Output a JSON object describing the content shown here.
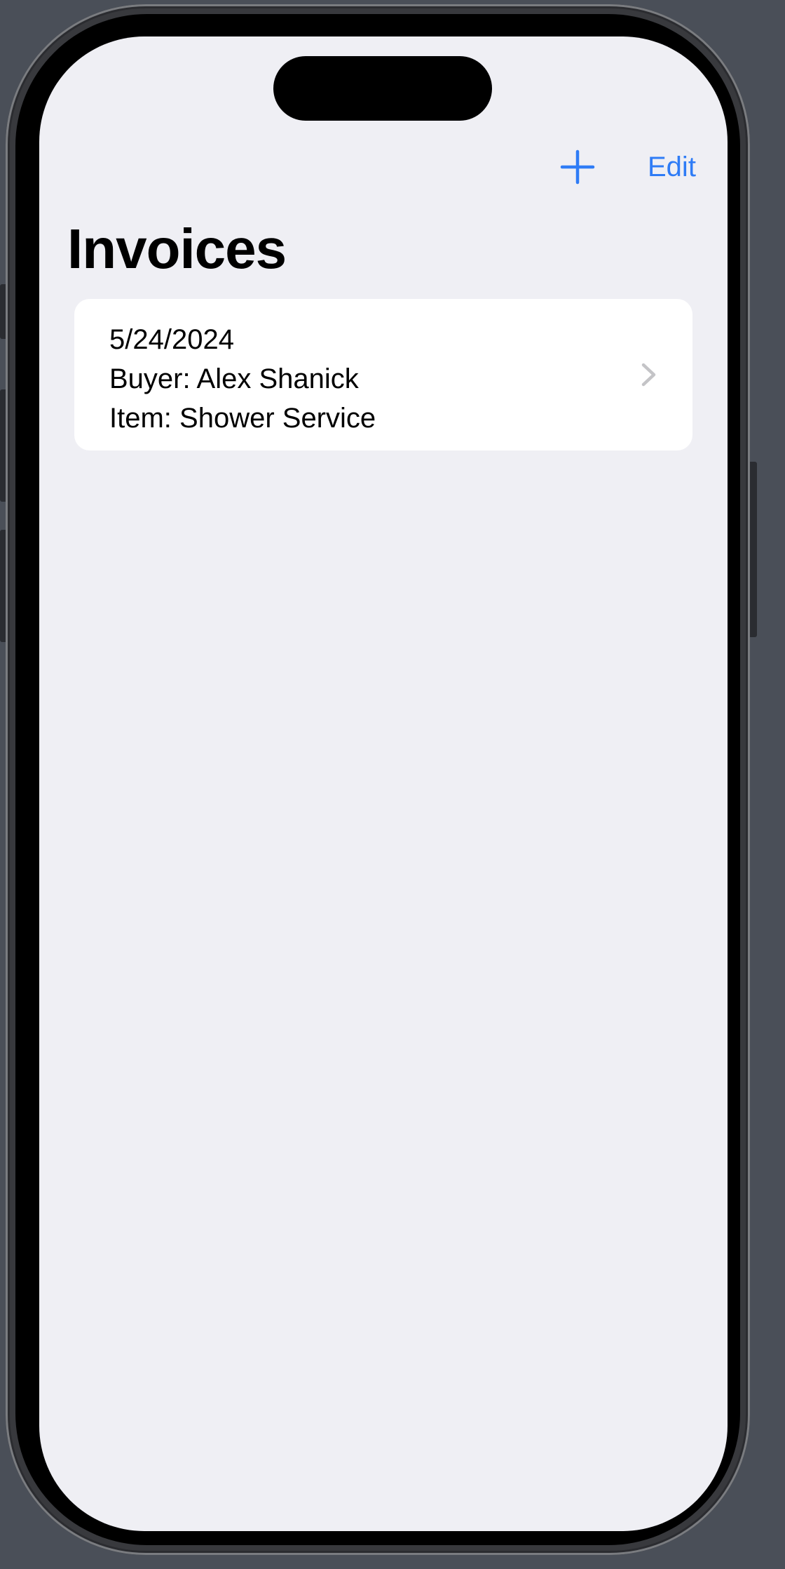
{
  "nav": {
    "add_icon": "plus-icon",
    "edit_label": "Edit"
  },
  "page": {
    "title": "Invoices"
  },
  "invoices": [
    {
      "date": "5/24/2024",
      "buyer": "Buyer: Alex Shanick",
      "item": "Item: Shower Service",
      "disclosure_icon": "chevron-right-icon"
    }
  ],
  "colors": {
    "accent": "#2f7cf6",
    "background": "#efeff4",
    "card": "#ffffff",
    "chevron": "#c4c4c7"
  }
}
